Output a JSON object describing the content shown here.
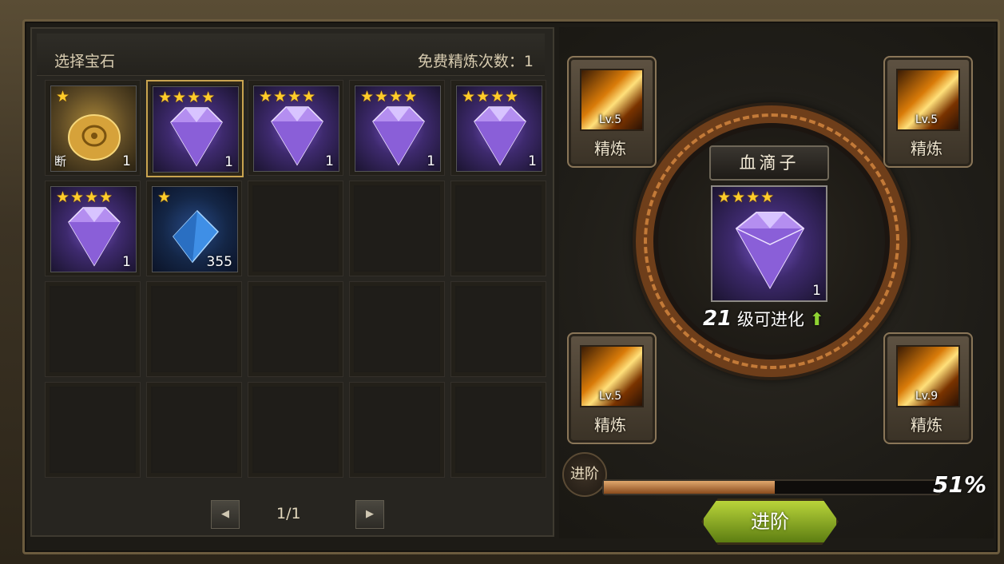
{
  "left_panel": {
    "title": "选择宝石",
    "free_refine_label": "免费精炼次数：1",
    "items": [
      {
        "type": "gold",
        "stars": 1,
        "count": "1",
        "tag": "断",
        "selected": false
      },
      {
        "type": "purple",
        "stars": 4,
        "count": "1",
        "tag": "",
        "selected": true
      },
      {
        "type": "purple",
        "stars": 4,
        "count": "1",
        "tag": "",
        "selected": false
      },
      {
        "type": "purple",
        "stars": 4,
        "count": "1",
        "tag": "",
        "selected": false
      },
      {
        "type": "purple",
        "stars": 4,
        "count": "1",
        "tag": "",
        "selected": false
      },
      {
        "type": "purple",
        "stars": 4,
        "count": "1",
        "tag": "",
        "selected": false
      },
      {
        "type": "blue",
        "stars": 1,
        "count": "355",
        "tag": "",
        "selected": false
      }
    ],
    "total_slots": 20,
    "pager": {
      "prev_icon": "left-arrow-icon",
      "next_icon": "right-arrow-icon",
      "text": "1/1"
    }
  },
  "right_panel": {
    "name": "血滴子",
    "center_item": {
      "stars": 4,
      "count": "1"
    },
    "evolve_level": "21",
    "evolve_text": "级可进化",
    "evolve_icon": "green-up-arrow-icon",
    "skills": [
      {
        "level": "Lv.5",
        "label": "精炼"
      },
      {
        "level": "Lv.5",
        "label": "精炼"
      },
      {
        "level": "Lv.5",
        "label": "精炼"
      },
      {
        "level": "Lv.9",
        "label": "精炼"
      }
    ],
    "progress_label": "进阶",
    "progress_pct_text": "51%",
    "progress_value": 0.51,
    "advance_button": "进阶"
  },
  "colors": {
    "star": "#ffcc2a",
    "selected_border": "#c9a450",
    "progress_fill": "#e1a86e",
    "advance_button": "#b9d43a"
  }
}
